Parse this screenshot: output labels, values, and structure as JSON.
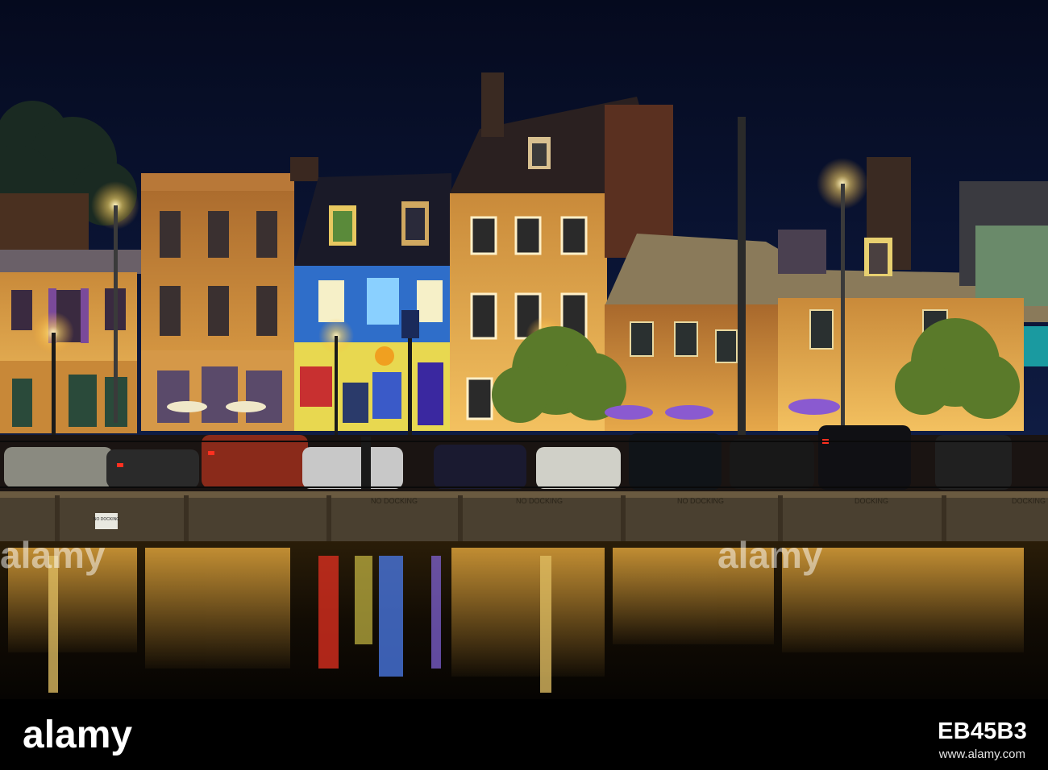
{
  "photo": {
    "subject": "harbor-waterfront-row-houses-night",
    "sign_no_docking": "NO DOCKING",
    "wall_text": [
      "NO DOCKING",
      "NO DOCKING",
      "NO DOCKING",
      "DOCKING",
      "DOCKING",
      "DOCKING"
    ]
  },
  "footer": {
    "logo": "alamy",
    "image_id": "EB45B3",
    "url": "www.alamy.com"
  },
  "colors": {
    "sky": "#0a1230",
    "water": "#0d0a05",
    "warm_light": "#f2b548",
    "blue_facade": "#2f6ec9"
  }
}
